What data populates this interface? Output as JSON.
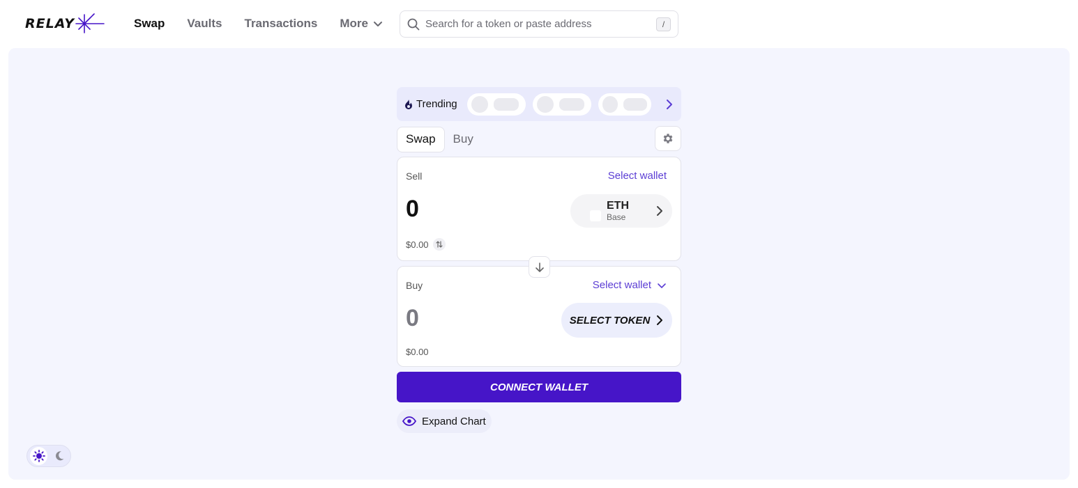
{
  "brand": {
    "name": "RELAY",
    "accent": "#4615c8",
    "link_color": "#5b3dd4",
    "background": "#f4f5fe"
  },
  "nav": {
    "items": [
      {
        "label": "Swap",
        "active": true
      },
      {
        "label": "Vaults",
        "active": false
      },
      {
        "label": "Transactions",
        "active": false
      },
      {
        "label": "More",
        "active": false
      }
    ]
  },
  "search": {
    "placeholder": "Search for a token or paste address",
    "shortcut": "/"
  },
  "trending": {
    "label": "Trending"
  },
  "tabs": {
    "swap": "Swap",
    "buy": "Buy"
  },
  "sell": {
    "label": "Sell",
    "wallet_link": "Select wallet",
    "amount": "0",
    "usd": "$0.00",
    "token_symbol": "ETH",
    "token_chain": "Base"
  },
  "buy": {
    "label": "Buy",
    "wallet_link": "Select wallet",
    "amount": "0",
    "usd": "$0.00",
    "select_token": "SELECT TOKEN"
  },
  "connect_wallet": "CONNECT WALLET",
  "expand_chart": "Expand Chart",
  "theme": {
    "selected": "light"
  }
}
